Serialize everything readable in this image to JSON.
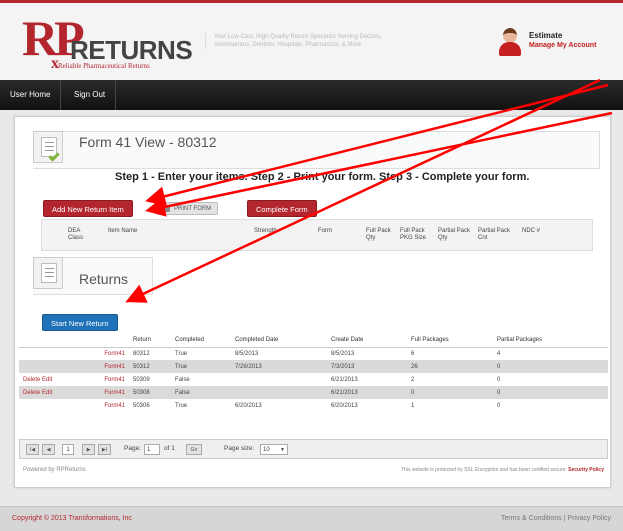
{
  "brand": {
    "logo_rp": "RP",
    "logo_returns": "RETURNS",
    "logo_sub": "Reliable Pharmaceutical Returns",
    "logo_x": "x",
    "tagline": "Your Low Cost, High Quality Return Specialist Serving Doctors, Veterinarians, Dentists, Hospitals, Pharmacists, & More"
  },
  "user": {
    "name": "Estimate",
    "manage_label": "Manage My Account"
  },
  "nav": {
    "home": "User Home",
    "signout": "Sign Out"
  },
  "form_panel": {
    "title": "Form 41 View - 80312",
    "steps": "Step 1 - Enter your items. Step 2 - Print your form. Step 3 - Complete your form.",
    "add_item_label": "Add New Return Item",
    "print_label": "PRINT FORM",
    "complete_label": "Complete Form",
    "columns": [
      "DEA Class",
      "Item Name",
      "Strength",
      "Form",
      "Full Pack Qty",
      "Full Pack PKG Size",
      "Partial Pack Qty",
      "Partial Pack Cnt",
      "NDC #"
    ]
  },
  "returns_panel": {
    "title": "Returns",
    "start_label": "Start New Return",
    "columns": [
      "",
      "",
      "Return",
      "Completed",
      "Completed Date",
      "Create Date",
      "Full Packages",
      "Partial Packages"
    ],
    "rows": [
      {
        "action": "",
        "form": "Form41",
        "return": "80312",
        "completed": "True",
        "completed_date": "8/5/2013",
        "create_date": "8/5/2013",
        "full": "6",
        "partial": "4"
      },
      {
        "action": "",
        "form": "Form41",
        "return": "50312",
        "completed": "True",
        "completed_date": "7/26/2013",
        "create_date": "7/3/2013",
        "full": "26",
        "partial": "0"
      },
      {
        "action": "Delete Edit",
        "form": "Form41",
        "return": "50309",
        "completed": "False",
        "completed_date": "",
        "create_date": "6/21/2013",
        "full": "2",
        "partial": "0"
      },
      {
        "action": "Delete Edit",
        "form": "Form41",
        "return": "50308",
        "completed": "False",
        "completed_date": "",
        "create_date": "6/21/2013",
        "full": "0",
        "partial": "0"
      },
      {
        "action": "",
        "form": "Form41",
        "return": "50306",
        "completed": "True",
        "completed_date": "6/20/2013",
        "create_date": "6/20/2013",
        "full": "1",
        "partial": "0"
      }
    ],
    "pager": {
      "first": "I◀",
      "prev": "◀",
      "current_page": "1",
      "next": "▶",
      "last": "▶I",
      "page_label": "Page:",
      "page_value": "1",
      "of_label": "of 1",
      "go_label": "Go",
      "size_label": "Page size:",
      "size_value": "10",
      "size_arrow": "▼"
    }
  },
  "bottom": {
    "powered": "Powered by RPReturns",
    "secure_text": "This website is protected by SSL Encryption and has been certified secure:",
    "secure_link": "Security Policy"
  },
  "footer": {
    "copyright": "Copyright © 2013 Transformations, Inc",
    "links": "Terms & Conditions | Privacy Policy"
  },
  "colors": {
    "brand_red": "#b3262e",
    "button_blue": "#1f72b8",
    "annotation_red": "#ff0000"
  }
}
